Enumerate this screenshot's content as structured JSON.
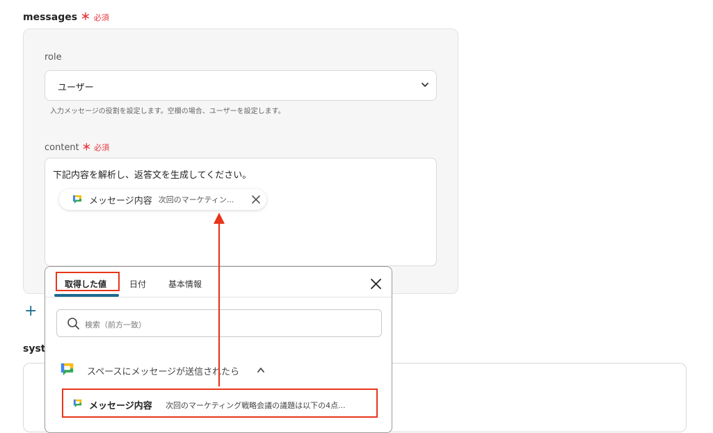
{
  "messages": {
    "label": "messages",
    "required_mark": "＊",
    "required_text": "必須",
    "role": {
      "label": "role",
      "selected": "ユーザー",
      "hint": "入力メッセージの役割を設定します。空欄の場合、ユーザーを設定します。"
    },
    "content": {
      "label": "content",
      "required_mark": "＊",
      "required_text": "必須",
      "text": "下記内容を解析し、返答文を生成してください。",
      "chip": {
        "name": "メッセージ内容",
        "value": "次回のマーケティン..."
      }
    },
    "add_symbol": "+"
  },
  "system": {
    "label_partial": "syst"
  },
  "picker": {
    "tabs": [
      {
        "label": "取得した値",
        "active": true
      },
      {
        "label": "日付",
        "active": false
      },
      {
        "label": "基本情報",
        "active": false
      }
    ],
    "search_placeholder": "検索（前方一致）",
    "section_title": "スペースにメッセージが送信されたら",
    "result": {
      "name": "メッセージ内容",
      "value": "次回のマーケティング戦略会議の議題は以下の4点..."
    }
  },
  "colors": {
    "accent": "#1c6a8e",
    "required": "#e8373e",
    "highlight": "#e8351a"
  }
}
